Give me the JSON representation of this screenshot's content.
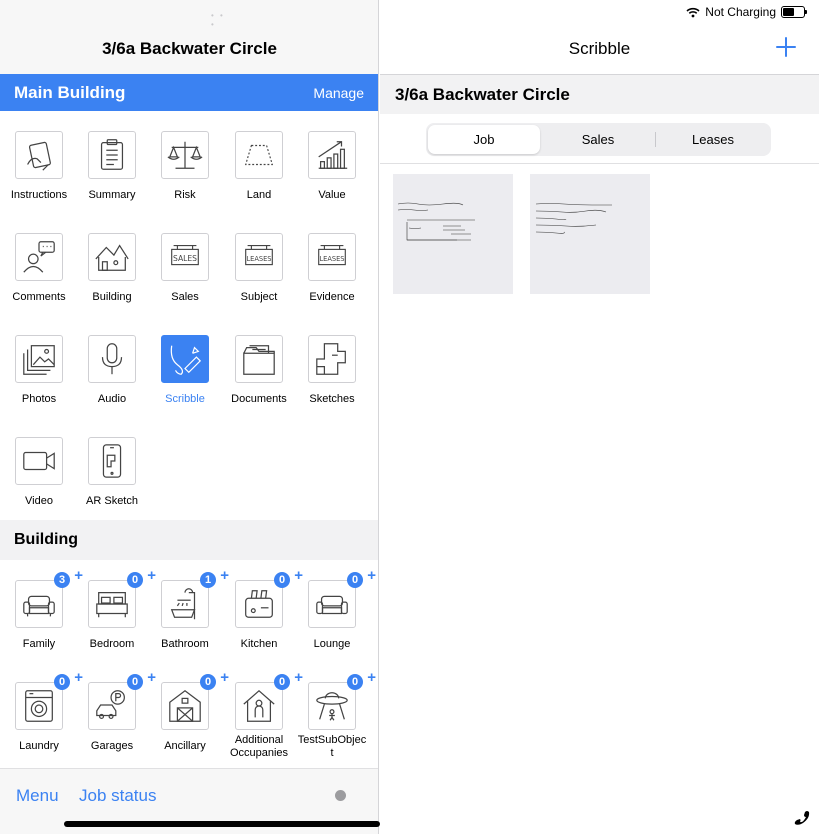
{
  "left": {
    "title": "3/6a Backwater Circle",
    "header": {
      "title": "Main Building",
      "manage_label": "Manage"
    },
    "tiles": [
      {
        "label": "Instructions"
      },
      {
        "label": "Summary"
      },
      {
        "label": "Risk"
      },
      {
        "label": "Land"
      },
      {
        "label": "Value"
      },
      {
        "label": "Comments"
      },
      {
        "label": "Building"
      },
      {
        "label": "Sales"
      },
      {
        "label": "Subject"
      },
      {
        "label": "Evidence"
      },
      {
        "label": "Photos"
      },
      {
        "label": "Audio"
      },
      {
        "label": "Scribble"
      },
      {
        "label": "Documents"
      },
      {
        "label": "Sketches"
      },
      {
        "label": "Video"
      },
      {
        "label": "AR Sketch"
      }
    ],
    "icon_text": {
      "sales": "SALES",
      "leases": "LEASES"
    },
    "section_title": "Building",
    "rooms": [
      {
        "label": "Family",
        "count": "3"
      },
      {
        "label": "Bedroom",
        "count": "0"
      },
      {
        "label": "Bathroom",
        "count": "1"
      },
      {
        "label": "Kitchen",
        "count": "0"
      },
      {
        "label": "Lounge",
        "count": "0"
      },
      {
        "label": "Laundry",
        "count": "0"
      },
      {
        "label": "Garages",
        "count": "0"
      },
      {
        "label": "Ancillary",
        "count": "0"
      },
      {
        "label": "Additional Occupanies",
        "count": "0"
      },
      {
        "label": "TestSubObject",
        "count": "0"
      }
    ],
    "bottom": {
      "menu_label": "Menu",
      "job_status_label": "Job status"
    }
  },
  "right": {
    "status_text": "Not Charging",
    "title": "Scribble",
    "subtitle": "3/6a Backwater Circle",
    "segments": [
      "Job",
      "Sales",
      "Leases"
    ],
    "selected_segment": "Job"
  },
  "colors": {
    "accent": "#3b82f2",
    "section_bg": "#f2f2f3"
  }
}
